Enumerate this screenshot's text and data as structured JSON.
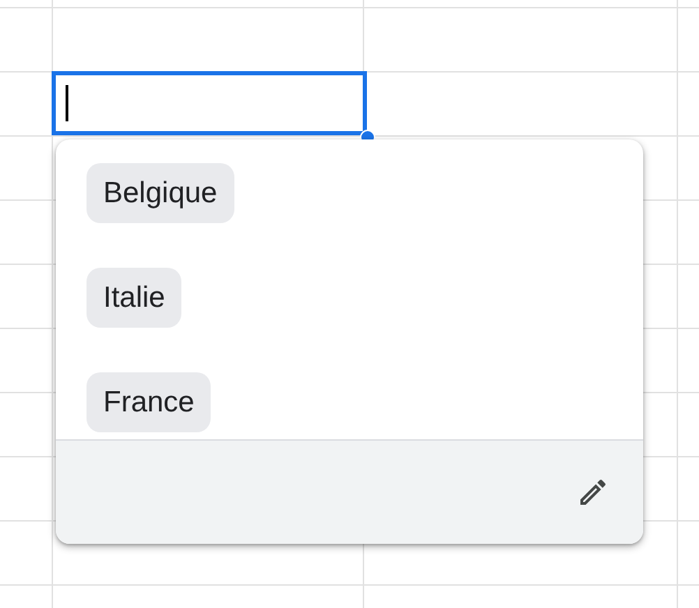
{
  "dropdown": {
    "options": [
      {
        "label": "Belgique"
      },
      {
        "label": "Italie"
      },
      {
        "label": "France"
      }
    ]
  }
}
